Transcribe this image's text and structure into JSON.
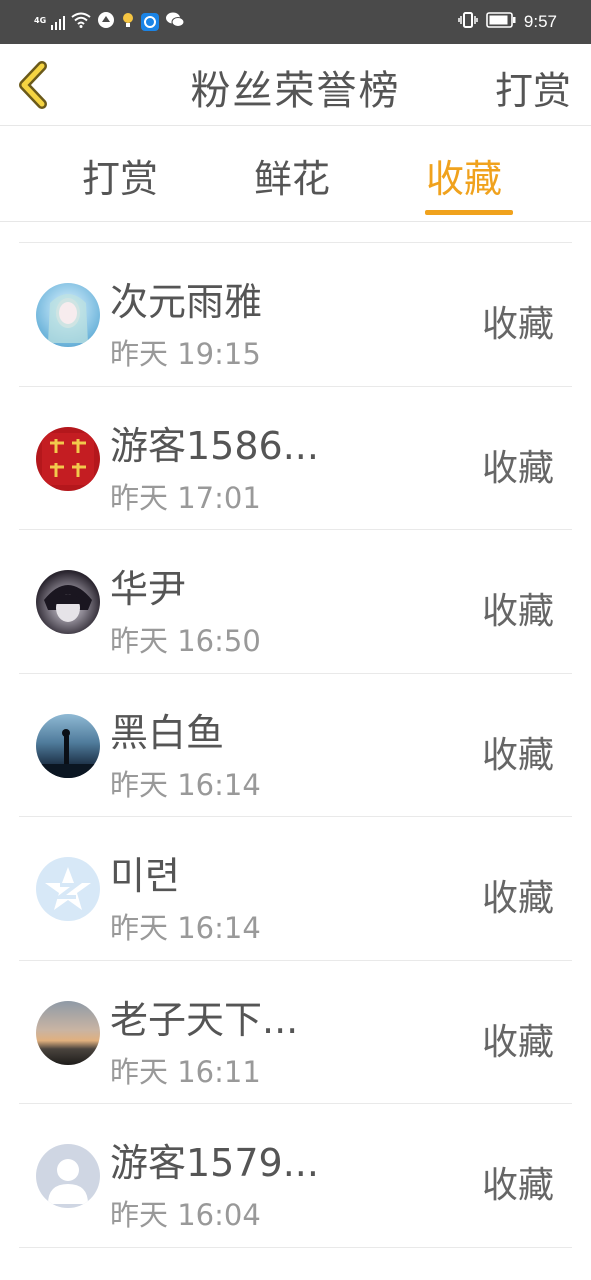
{
  "status_bar": {
    "network": "4G",
    "time": "9:57"
  },
  "header": {
    "title": "粉丝荣誉榜",
    "action": "打赏",
    "back_icon": "chevron-left-icon"
  },
  "colors": {
    "accent": "#f0a21d",
    "text": "#555555",
    "subtext": "#999999",
    "status_bar": "#4a4a4a"
  },
  "tabs": [
    {
      "label": "打赏",
      "active": false
    },
    {
      "label": "鲜花",
      "active": false
    },
    {
      "label": "收藏",
      "active": true
    }
  ],
  "fans": [
    {
      "name": "次元雨雅",
      "time": "昨天 19:15",
      "action": "收藏"
    },
    {
      "name": "游客1586...",
      "time": "昨天 17:01",
      "action": "收藏"
    },
    {
      "name": "华尹",
      "time": "昨天 16:50",
      "action": "收藏"
    },
    {
      "name": "黑白鱼",
      "time": "昨天 16:14",
      "action": "收藏"
    },
    {
      "name": "미련",
      "time": "昨天 16:14",
      "action": "收藏"
    },
    {
      "name": "老子天下...",
      "time": "昨天 16:11",
      "action": "收藏"
    },
    {
      "name": "游客1579...",
      "time": "昨天 16:04",
      "action": "收藏"
    }
  ]
}
